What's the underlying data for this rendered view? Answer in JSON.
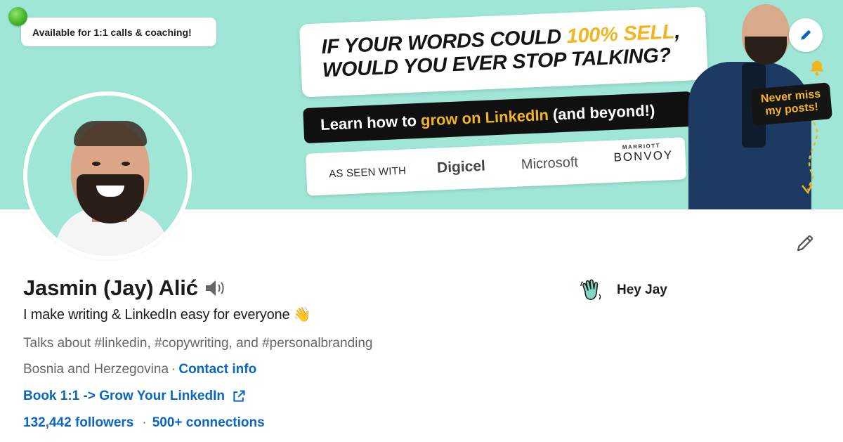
{
  "banner": {
    "availability": "Available for 1:1 calls & coaching!",
    "headline_line1_pre": "IF YOUR WORDS COULD ",
    "headline_line1_accent": "100% SELL",
    "headline_line1_post": ",",
    "headline_line2": "WOULD YOU EVER STOP TALKING?",
    "learn_pre": "Learn how to",
    "learn_accent": "grow on LinkedIn",
    "learn_post": "(and beyond!)",
    "seen_with": "AS SEEN WITH",
    "brands": {
      "digicel": "Digicel",
      "microsoft": "Microsoft",
      "marriott_small": "MARRIOTT",
      "marriott_big": "BONVOY"
    },
    "never_miss_line1": "Never miss",
    "never_miss_line2": "my posts!"
  },
  "profile": {
    "name": "Jasmin (Jay) Alić",
    "headline": "I make writing & LinkedIn easy for everyone 👋",
    "talks_about": "Talks about #linkedin, #copywriting, and #personalbranding",
    "location": "Bosnia and Herzegovina",
    "location_sep": "·",
    "contact_info": "Contact info",
    "book_link": "Book 1:1 -> Grow Your LinkedIn",
    "followers": "132,442 followers",
    "stats_sep": "·",
    "connections": "500+ connections",
    "hey": "Hey Jay"
  },
  "colors": {
    "banner_bg": "#9fe6d7",
    "accent_yellow": "#f2b522",
    "link_blue": "#0a66c2"
  },
  "icons": [
    "status-dot-icon",
    "pencil-icon",
    "bell-icon",
    "speaker-icon",
    "external-link-icon",
    "wave-hand-icon"
  ]
}
